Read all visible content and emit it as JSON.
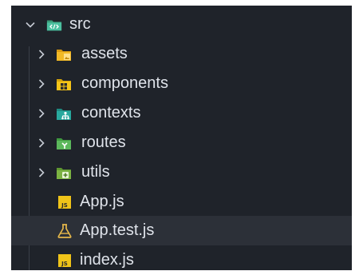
{
  "explorer": {
    "root": {
      "label": "src",
      "icon": "code-folder-icon",
      "expanded": true
    },
    "items": [
      {
        "label": "assets",
        "kind": "folder",
        "icon": "assets-folder-icon",
        "expanded": false,
        "color": "#f2b926"
      },
      {
        "label": "components",
        "kind": "folder",
        "icon": "components-folder-icon",
        "expanded": false,
        "color": "#f5c518"
      },
      {
        "label": "contexts",
        "kind": "folder",
        "icon": "contexts-folder-icon",
        "expanded": false,
        "color": "#28a99e"
      },
      {
        "label": "routes",
        "kind": "folder",
        "icon": "routes-folder-icon",
        "expanded": false,
        "color": "#5cb85c"
      },
      {
        "label": "utils",
        "kind": "folder",
        "icon": "utils-folder-icon",
        "expanded": false,
        "color": "#7cb342"
      },
      {
        "label": "App.js",
        "kind": "file",
        "icon": "javascript-file-icon",
        "color": "#f0c419"
      },
      {
        "label": "App.test.js",
        "kind": "file",
        "icon": "test-flask-icon",
        "color": "#e5b74a",
        "highlighted": true
      },
      {
        "label": "index.js",
        "kind": "file",
        "icon": "javascript-file-icon",
        "color": "#f0c419"
      }
    ]
  }
}
